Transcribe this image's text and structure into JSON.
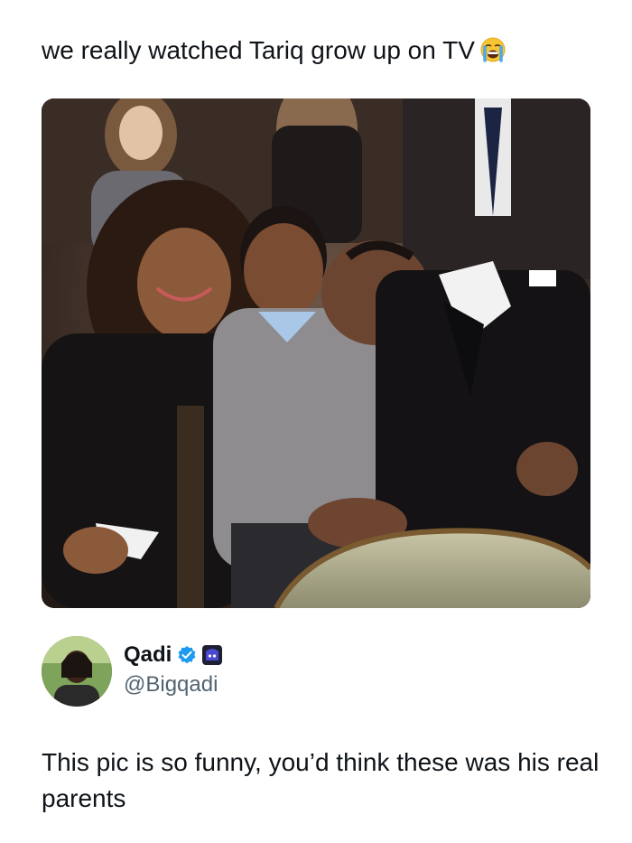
{
  "post": {
    "headline": "we really watched Tariq grow up on TV",
    "headline_emoji": "loudly-crying-face-emoji",
    "photo": {
      "subject": "photo-of-four-people-seated-in-theater"
    }
  },
  "quoted_tweet": {
    "author": {
      "display_name": "Qadi",
      "handle": "@Bigqadi",
      "verified": true,
      "verified_badge_color": "#1d9bf0",
      "affiliate_badge_color": "#3b3bb5"
    },
    "text": "This pic is so funny, you’d think these was his real parents"
  },
  "colors": {
    "text_primary": "#0f1419",
    "text_secondary": "#536471",
    "background": "#ffffff"
  }
}
